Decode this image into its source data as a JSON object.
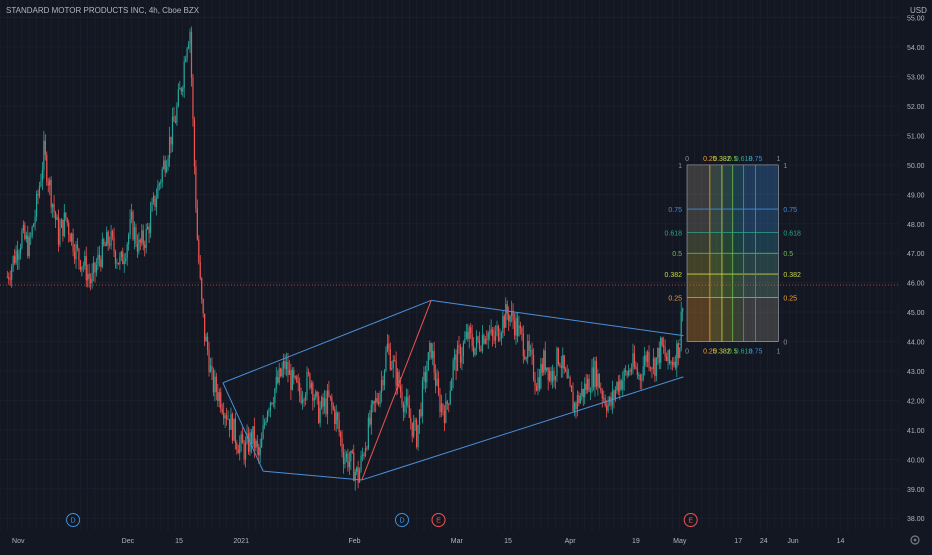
{
  "header": {
    "symbol_title": "STANDARD MOTOR PRODUCTS INC, 4h, Cboe BZX",
    "currency": "USD"
  },
  "colors": {
    "background": "#131722",
    "grid": "#1e2230",
    "up": "#26a69a",
    "down": "#ef5350",
    "trendline": "#4a90d9",
    "price_tag": "#ef5350",
    "fib_025": "#f59d2a",
    "fib_0382": "#c7d646",
    "fib_05": "#6fbf4a",
    "fib_0618": "#2ea58a",
    "fib_075": "#3d8fdc",
    "fib_1": "#8a8e99"
  },
  "chart_data": {
    "type": "candlestick",
    "title": "STANDARD MOTOR PRODUCTS INC, 4h, Cboe BZX",
    "x_tick_labels": [
      "Nov",
      "Dec",
      "15",
      "2021",
      "Feb",
      "Mar",
      "15",
      "Apr",
      "19",
      "May",
      "17",
      "24",
      "Jun",
      "14"
    ],
    "x_tick_dates": [
      "2020-11-01",
      "2020-12-01",
      "2020-12-15",
      "2021-01-01",
      "2021-02-01",
      "2021-03-01",
      "2021-03-15",
      "2021-04-01",
      "2021-04-19",
      "2021-05-01",
      "2021-05-17",
      "2021-05-24",
      "2021-06-01",
      "2021-06-14"
    ],
    "ylim": [
      37.6,
      55.6
    ],
    "y_ticks": [
      "38.00",
      "39.00",
      "40.00",
      "41.00",
      "42.00",
      "43.00",
      "44.00",
      "45.00",
      "46.00",
      "47.00",
      "48.00",
      "49.00",
      "50.00",
      "51.00",
      "52.00",
      "53.00",
      "54.00",
      "55.00"
    ],
    "last_price": "45.92",
    "last_price_value": 45.92,
    "price_points": [
      [
        "2020-10-29",
        46.2
      ],
      [
        "2020-11-02",
        47.6
      ],
      [
        "2020-11-04",
        47.2
      ],
      [
        "2020-11-06",
        48.6
      ],
      [
        "2020-11-08",
        50.4
      ],
      [
        "2020-11-10",
        49.0
      ],
      [
        "2020-11-12",
        47.6
      ],
      [
        "2020-11-14",
        48.2
      ],
      [
        "2020-11-17",
        47.0
      ],
      [
        "2020-11-19",
        46.6
      ],
      [
        "2020-11-21",
        46.0
      ],
      [
        "2020-11-23",
        46.8
      ],
      [
        "2020-11-26",
        47.5
      ],
      [
        "2020-11-29",
        46.6
      ],
      [
        "2020-12-02",
        48.0
      ],
      [
        "2020-12-04",
        47.2
      ],
      [
        "2020-12-06",
        47.6
      ],
      [
        "2020-12-08",
        48.6
      ],
      [
        "2020-12-10",
        49.6
      ],
      [
        "2020-12-12",
        50.6
      ],
      [
        "2020-12-14",
        51.6
      ],
      [
        "2020-12-16",
        53.0
      ],
      [
        "2020-12-17",
        54.2
      ],
      [
        "2020-12-18",
        54.6
      ],
      [
        "2020-12-19",
        50.6
      ],
      [
        "2020-12-20",
        47.5
      ],
      [
        "2020-12-21",
        45.5
      ],
      [
        "2020-12-22",
        44.2
      ],
      [
        "2020-12-23",
        43.6
      ],
      [
        "2020-12-24",
        42.6
      ],
      [
        "2020-12-26",
        42.2
      ],
      [
        "2020-12-28",
        41.6
      ],
      [
        "2020-12-31",
        40.6
      ],
      [
        "2021-01-02",
        40.3
      ],
      [
        "2021-01-04",
        40.8
      ],
      [
        "2021-01-06",
        40.0
      ],
      [
        "2021-01-08",
        41.8
      ],
      [
        "2021-01-11",
        42.6
      ],
      [
        "2021-01-13",
        43.2
      ],
      [
        "2021-01-15",
        42.6
      ],
      [
        "2021-01-17",
        42.2
      ],
      [
        "2021-01-20",
        42.8
      ],
      [
        "2021-01-22",
        41.6
      ],
      [
        "2021-01-25",
        42.0
      ],
      [
        "2021-01-27",
        41.4
      ],
      [
        "2021-01-29",
        40.2
      ],
      [
        "2021-01-31",
        39.9
      ],
      [
        "2021-02-02",
        39.4
      ],
      [
        "2021-02-04",
        40.6
      ],
      [
        "2021-02-06",
        41.6
      ],
      [
        "2021-02-08",
        42.4
      ],
      [
        "2021-02-10",
        43.8
      ],
      [
        "2021-02-12",
        43.0
      ],
      [
        "2021-02-14",
        42.2
      ],
      [
        "2021-02-16",
        41.4
      ],
      [
        "2021-02-18",
        40.8
      ],
      [
        "2021-02-20",
        42.6
      ],
      [
        "2021-02-22",
        43.8
      ],
      [
        "2021-02-24",
        42.0
      ],
      [
        "2021-02-26",
        41.6
      ],
      [
        "2021-02-28",
        43.2
      ],
      [
        "2021-03-02",
        43.6
      ],
      [
        "2021-03-04",
        44.2
      ],
      [
        "2021-03-06",
        43.8
      ],
      [
        "2021-03-09",
        44.4
      ],
      [
        "2021-03-11",
        44.0
      ],
      [
        "2021-03-13",
        44.6
      ],
      [
        "2021-03-15",
        45.0
      ],
      [
        "2021-03-17",
        44.6
      ],
      [
        "2021-03-19",
        44.0
      ],
      [
        "2021-03-21",
        43.4
      ],
      [
        "2021-03-23",
        42.6
      ],
      [
        "2021-03-25",
        43.4
      ],
      [
        "2021-03-27",
        42.8
      ],
      [
        "2021-03-29",
        43.6
      ],
      [
        "2021-03-31",
        42.6
      ],
      [
        "2021-04-02",
        41.8
      ],
      [
        "2021-04-04",
        42.2
      ],
      [
        "2021-04-06",
        42.6
      ],
      [
        "2021-04-08",
        43.0
      ],
      [
        "2021-04-10",
        42.2
      ],
      [
        "2021-04-12",
        41.8
      ],
      [
        "2021-04-14",
        42.6
      ],
      [
        "2021-04-16",
        42.8
      ],
      [
        "2021-04-18",
        43.2
      ],
      [
        "2021-04-20",
        42.8
      ],
      [
        "2021-04-22",
        43.6
      ],
      [
        "2021-04-24",
        43.2
      ],
      [
        "2021-04-26",
        43.8
      ],
      [
        "2021-04-28",
        43.2
      ],
      [
        "2021-04-30",
        43.6
      ],
      [
        "2021-05-01",
        44.0
      ],
      [
        "2021-05-02",
        45.92
      ]
    ],
    "trendlines": [
      {
        "name": "wedge-upper-left",
        "from": [
          "2020-12-27",
          42.6
        ],
        "to": [
          "2021-02-22",
          45.4
        ]
      },
      {
        "name": "wedge-upper-right",
        "from": [
          "2021-02-22",
          45.4
        ],
        "to": [
          "2021-05-02",
          44.2
        ]
      },
      {
        "name": "wedge-lower-left",
        "from": [
          "2021-01-07",
          39.6
        ],
        "to": [
          "2021-02-03",
          39.3
        ]
      },
      {
        "name": "wedge-lower-right",
        "from": [
          "2021-02-03",
          39.3
        ],
        "to": [
          "2021-05-02",
          42.8
        ]
      },
      {
        "name": "wedge-left-edge",
        "from": [
          "2020-12-27",
          42.6
        ],
        "to": [
          "2021-01-07",
          39.6
        ]
      },
      {
        "name": "red-diagonal",
        "from": [
          "2021-02-03",
          39.3
        ],
        "to": [
          "2021-02-22",
          45.4
        ]
      }
    ],
    "fib_box": {
      "x_start": "2021-05-03",
      "x_end": "2021-05-28",
      "y_bottom": 44.0,
      "y_top": 50.0,
      "levels": [
        {
          "label": "0",
          "value": 0,
          "color_key": "fib_1"
        },
        {
          "label": "0.25",
          "value": 0.25,
          "color_key": "fib_025"
        },
        {
          "label": "0.382",
          "value": 0.382,
          "color_key": "fib_0382"
        },
        {
          "label": "0.5",
          "value": 0.5,
          "color_key": "fib_05"
        },
        {
          "label": "0.618",
          "value": 0.618,
          "color_key": "fib_0618"
        },
        {
          "label": "0.75",
          "value": 0.75,
          "color_key": "fib_075"
        },
        {
          "label": "1",
          "value": 1,
          "color_key": "fib_1"
        }
      ]
    },
    "event_markers": [
      {
        "label": "D",
        "date": "2020-11-16",
        "color_key": "fib_075"
      },
      {
        "label": "D",
        "date": "2021-02-14",
        "color_key": "fib_075"
      },
      {
        "label": "E",
        "date": "2021-02-24",
        "color_key": "down"
      },
      {
        "label": "E",
        "date": "2021-05-04",
        "color_key": "down"
      }
    ]
  }
}
